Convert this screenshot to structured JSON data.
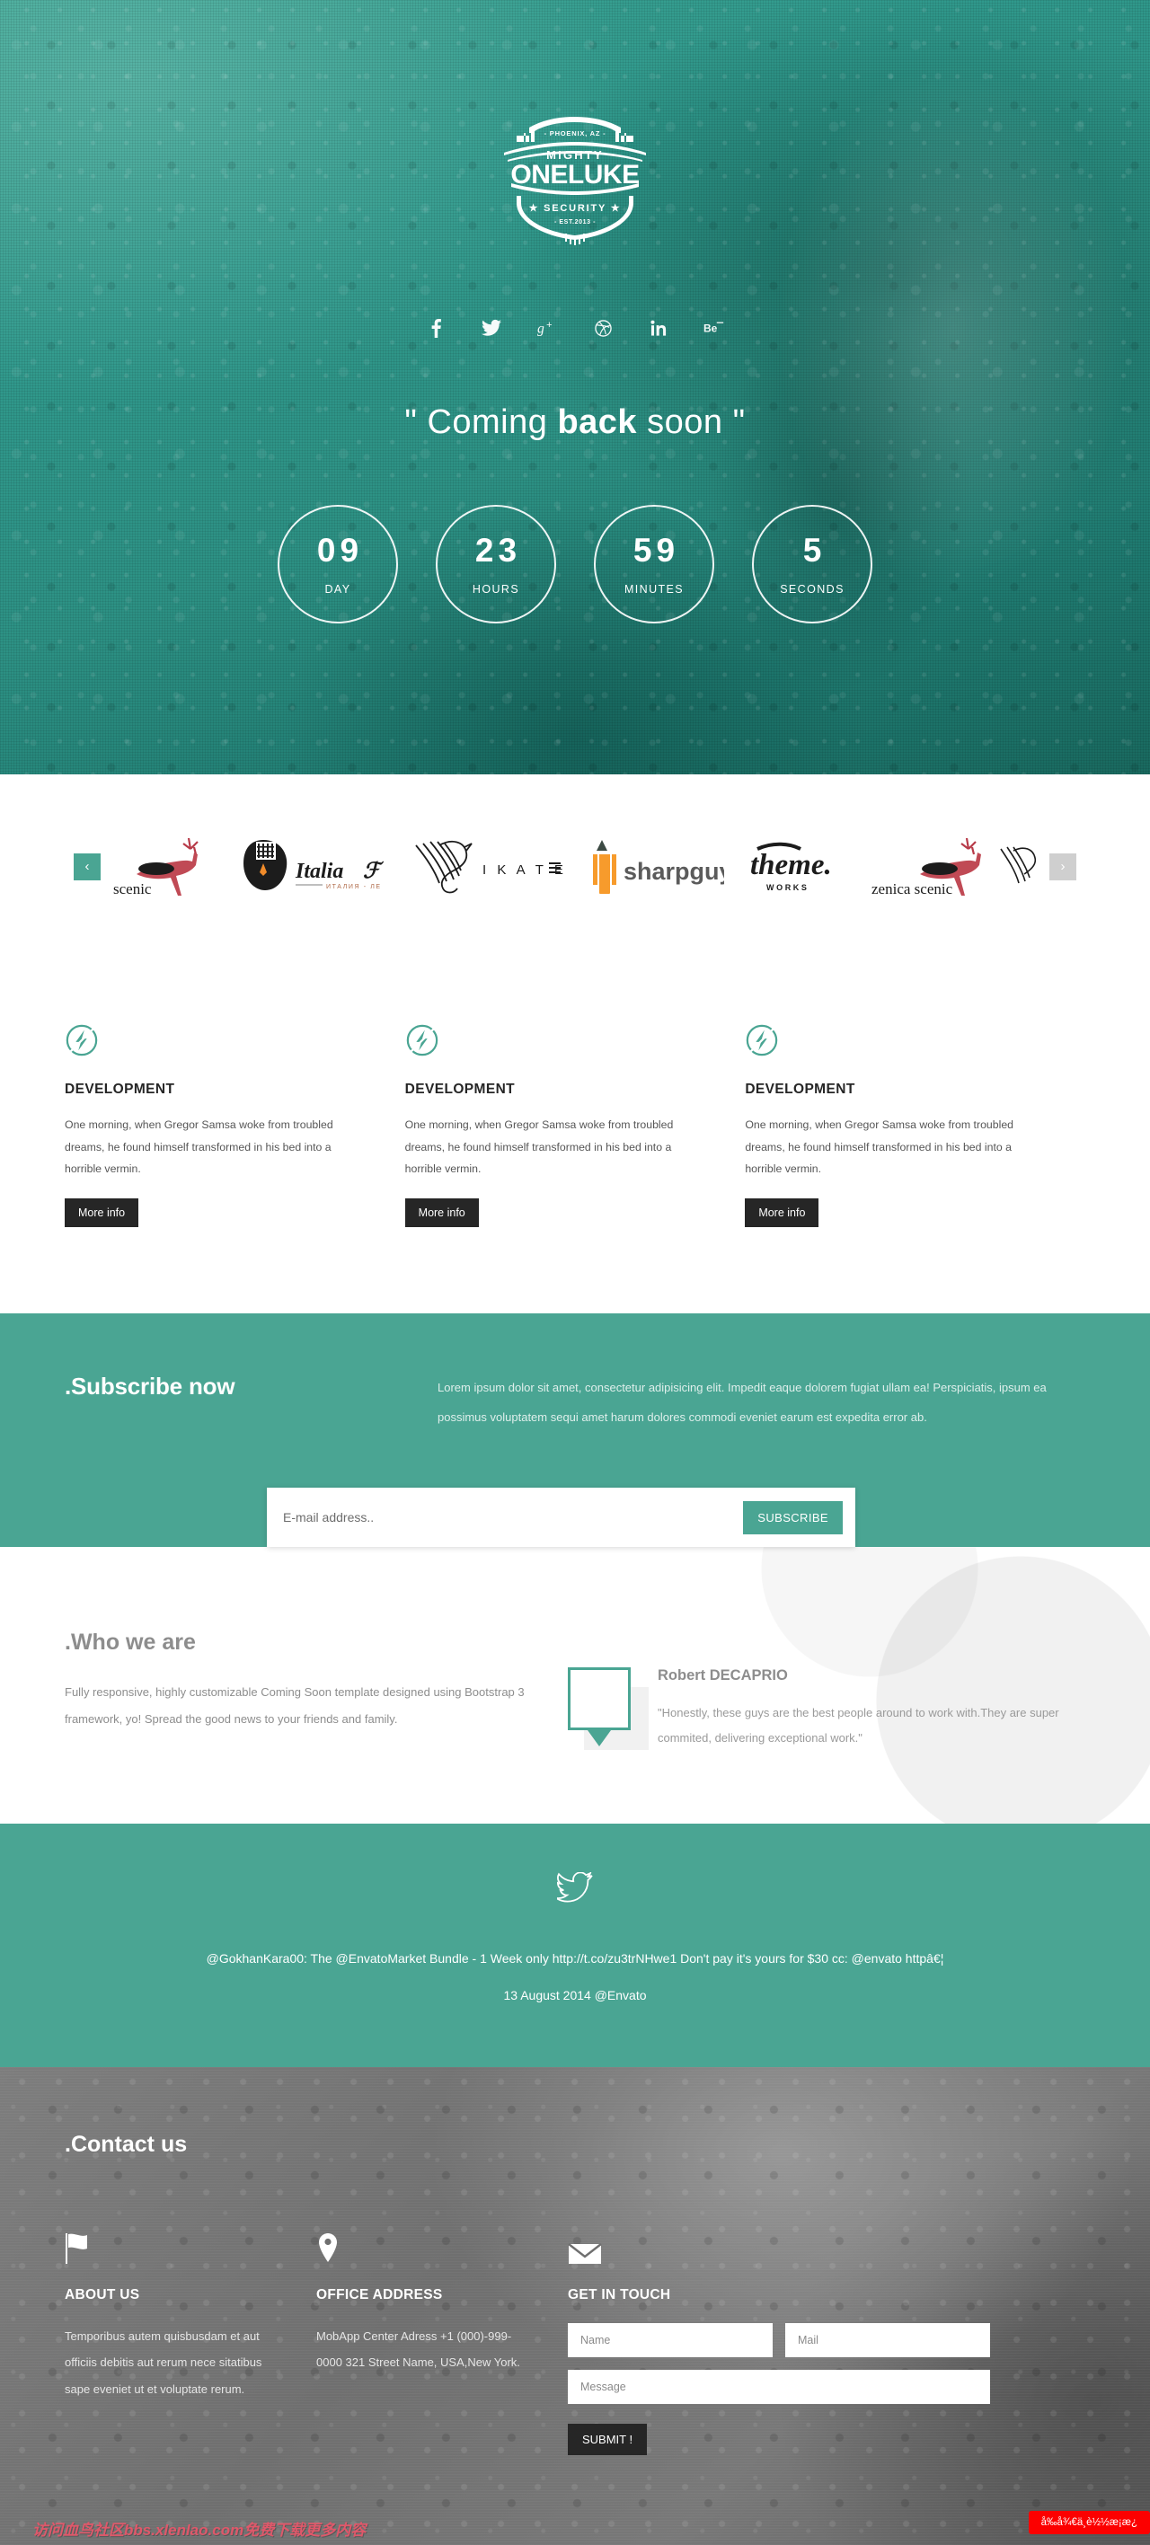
{
  "hero": {
    "logo": {
      "location": "- PHOENIX, AZ -",
      "top_word": "MIGHTY",
      "brand": "ONELUKE",
      "bottom_word": "SECURITY",
      "est": "- EST.2013 -"
    },
    "socials": [
      {
        "name": "facebook",
        "glyph": "f"
      },
      {
        "name": "twitter",
        "glyph": "t"
      },
      {
        "name": "google-plus",
        "glyph": "g+"
      },
      {
        "name": "dribbble",
        "glyph": "d"
      },
      {
        "name": "linkedin",
        "glyph": "in"
      },
      {
        "name": "behance",
        "glyph": "Be"
      }
    ],
    "title_quote_open": "\"",
    "title_part1": "Coming ",
    "title_bold": "back",
    "title_part2": " soon",
    "title_quote_close": "\"",
    "countdown": [
      {
        "value": "09",
        "label": "DAY"
      },
      {
        "value": "23",
        "label": "HOURS"
      },
      {
        "value": "59",
        "label": "MINUTES"
      },
      {
        "value": "5",
        "label": "SECONDS"
      }
    ]
  },
  "clients": {
    "prev_label": "‹",
    "next_label": "›",
    "logos": [
      {
        "name": "scenic",
        "text": "scenic"
      },
      {
        "name": "italia",
        "text": "Italia",
        "sub": "ИТАЛИЯ - ЛЕ"
      },
      {
        "name": "ikater",
        "text": "I K A T E R"
      },
      {
        "name": "sharpguy",
        "text": "sharpguy"
      },
      {
        "name": "theme-works",
        "text": "theme.",
        "sub": "W O R K S"
      },
      {
        "name": "zenica-scenic",
        "text": "zenica scenic"
      }
    ]
  },
  "services": [
    {
      "icon": "bolt-circle-icon",
      "title": "DEVELOPMENT",
      "text": "One morning, when Gregor Samsa woke from troubled dreams, he found himself transformed in his bed into a horrible vermin.",
      "button": "More info"
    },
    {
      "icon": "bolt-circle-icon",
      "title": "DEVELOPMENT",
      "text": "One morning, when Gregor Samsa woke from troubled dreams, he found himself transformed in his bed into a horrible vermin.",
      "button": "More info"
    },
    {
      "icon": "bolt-circle-icon",
      "title": "DEVELOPMENT",
      "text": "One morning, when Gregor Samsa woke from troubled dreams, he found himself transformed in his bed into a horrible vermin.",
      "button": "More info"
    }
  ],
  "subscribe": {
    "heading": ".Subscribe now",
    "paragraph": "Lorem ipsum dolor sit amet, consectetur adipisicing elit. Impedit eaque dolorem fugiat ullam ea! Perspiciatis, ipsum ea possimus voluptatem sequi amet harum dolores commodi eveniet earum est expedita error ab.",
    "email_placeholder": "E-mail address..",
    "email_value": "",
    "button": "SUBSCRIBE"
  },
  "who": {
    "heading": ".Who we are",
    "paragraph": "Fully responsive, highly customizable Coming Soon template designed using Bootstrap 3 framework, yo! Spread the good news to your friends and family.",
    "testimonial": {
      "name": "Robert DECAPRIO",
      "quote": "\"Honestly, these guys are the best people around to work with.They are super commited, delivering exceptional work.\""
    }
  },
  "twitter": {
    "icon": "twitter-bird-icon",
    "tweet": "@GokhanKara00: The @EnvatoMarket Bundle - 1 Week only http://t.co/zu3trNHwe1 Don't pay it's yours for $30 cc: @envato httpâ€¦",
    "meta": "13 August 2014 @Envato"
  },
  "contact": {
    "heading": ".Contact us",
    "columns": [
      {
        "icon": "flag-icon",
        "title": "ABOUT US",
        "text": "Temporibus autem quisbusdam et aut officiis debitis aut rerum nece sitatibus sape eveniet ut et voluptate rerum."
      },
      {
        "icon": "map-pin-icon",
        "title": "OFFICE ADDRESS",
        "text": "MobApp Center Adress +1 (000)-999-0000 321 Street Name, USA,New York."
      }
    ],
    "form": {
      "icon": "envelope-icon",
      "title": "GET IN TOUCH",
      "name_placeholder": "Name",
      "name_value": "",
      "mail_placeholder": "Mail",
      "mail_value": "",
      "message_placeholder": "Message",
      "message_value": "",
      "submit": "SUBMIT !"
    },
    "red_badge": "å‰å¾€ä¸è½½æ¡æ¿",
    "watermark": "访问血鸟社区bbs.xlenlao.com免费下载更多内容"
  },
  "colors": {
    "teal": "#4aa593",
    "dark": "#262626",
    "red": "#fc0000"
  }
}
